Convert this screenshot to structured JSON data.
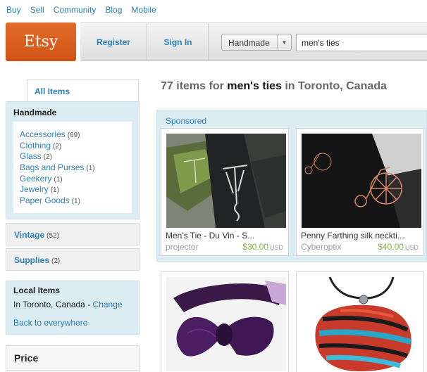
{
  "top_nav": [
    "Buy",
    "Sell",
    "Community",
    "Blog",
    "Mobile"
  ],
  "logo": "Etsy",
  "header": {
    "register": "Register",
    "sign_in": "Sign In",
    "category_select": "Handmade",
    "search_value": "men's ties"
  },
  "sidebar": {
    "all_items_tab": "All Items",
    "handmade": {
      "title": "Handmade",
      "items": [
        {
          "label": "Accessories",
          "count": "(69)"
        },
        {
          "label": "Clothing",
          "count": "(2)"
        },
        {
          "label": "Glass",
          "count": "(2)"
        },
        {
          "label": "Bags and Purses",
          "count": "(1)"
        },
        {
          "label": "Geekery",
          "count": "(1)"
        },
        {
          "label": "Jewelry",
          "count": "(1)"
        },
        {
          "label": "Paper Goods",
          "count": "(1)"
        }
      ]
    },
    "vintage": {
      "label": "Vintage",
      "count": "(52)"
    },
    "supplies": {
      "label": "Supplies",
      "count": "(2)"
    },
    "local": {
      "title": "Local Items",
      "location_prefix": "In Toronto, Canada - ",
      "change_link": "Change",
      "back_link": "Back to everywhere"
    },
    "price_title": "Price"
  },
  "results": {
    "prefix": "77 items for ",
    "query": "men's ties",
    "suffix": " in Toronto, Canada"
  },
  "sponsored_label": "Sponsored",
  "listings": [
    {
      "title": "Men's Tie - Du Vin - S...",
      "shop": "projector",
      "price": "$30.00",
      "currency": "USD"
    },
    {
      "title": "Penny Farthing silk neckti...",
      "shop": "Cyberoptix",
      "price": "$40.00",
      "currency": "USD"
    }
  ],
  "colors": {
    "brand_orange": "#e46c2a",
    "link_blue": "#2a7fb8",
    "price_green": "#77b93a",
    "panel_blue": "#dcecf3"
  }
}
